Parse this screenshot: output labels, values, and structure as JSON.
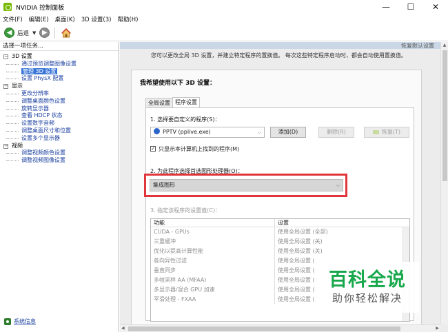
{
  "window": {
    "title": "NVIDIA 控制面板",
    "minimize": "—",
    "maximize": "☐",
    "close": "✕"
  },
  "menu": [
    "文件(F)",
    "编辑(E)",
    "桌面(K)",
    "3D 设置(3)",
    "帮助(H)"
  ],
  "toolbar": {
    "back_label": "后退"
  },
  "left_panel": {
    "header": "选择一项任务...",
    "tree": [
      {
        "label": "3D 设置",
        "level": 0
      },
      {
        "label": "通过预览调整图像设置",
        "level": 1
      },
      {
        "label": "管理 3D 设置",
        "level": 1,
        "selected": true
      },
      {
        "label": "设置 PhysX 配置",
        "level": 1
      },
      {
        "label": "显示",
        "level": 0
      },
      {
        "label": "更改分辨率",
        "level": 1
      },
      {
        "label": "调整桌面颜色设置",
        "level": 1
      },
      {
        "label": "旋转显示器",
        "level": 1
      },
      {
        "label": "查看 HDCP 状态",
        "level": 1
      },
      {
        "label": "设置数字音频",
        "level": 1
      },
      {
        "label": "调整桌面尺寸和位置",
        "level": 1
      },
      {
        "label": "设置多个显示器",
        "level": 1
      },
      {
        "label": "视频",
        "level": 0
      },
      {
        "label": "调整视频颜色设置",
        "level": 1
      },
      {
        "label": "调整视频图像设置",
        "level": 1
      }
    ],
    "system_info": "系统信息"
  },
  "right_panel": {
    "restore_defaults_top": "恢复默认设置",
    "description": "您可以更改全局 3D 设置，并建立特定程序的置换值。 每次这些特定程序启动时，都会自动使用置换值。",
    "section_title": "我希望使用以下 3D 设置：",
    "tabs": {
      "global": "全局设置",
      "program": "程序设置"
    },
    "step1_label": "1. 选择要自定义的程序(S)：",
    "program_select": "PPTV (pplive.exe)",
    "add_button": "添加(D)",
    "delete_button": "删除(R)",
    "restore_button": "恢复(T)",
    "only_show_checkbox": "只显示本计算机上找到的程序(M)",
    "step2_label": "2. 为此程序选择首选图形处理器(O)：",
    "gpu_select": "集成图形",
    "step3_label": "3. 指定该程序的设置值(C)：",
    "table": {
      "headers": [
        "功能",
        "设置"
      ],
      "rows": [
        [
          "CUDA - GPUs",
          "使用全局设置 (全部)"
        ],
        [
          "三重缓冲",
          "使用全局设置 (关)"
        ],
        [
          "优化以提高计算性能",
          "使用全局设置 (关)"
        ],
        [
          "各向异性过滤",
          "使用全局设置 ("
        ],
        [
          "垂直同步",
          "使用全局设置 ("
        ],
        [
          "多帧采样 AA (MFAA)",
          "使用全局设置 ("
        ],
        [
          "多显示器/混合 GPU 加速",
          "使用全局设置 ("
        ],
        [
          "平滑处理 - FXAA",
          "使用全局设置 ("
        ]
      ]
    }
  },
  "watermark": {
    "main": "百科全说",
    "sub": "助你轻松解决"
  },
  "colors": {
    "accent_selected": "#3875d7",
    "highlight": "#e0353b",
    "nvidia_green": "#76b900",
    "watermark_green": "#17a84b"
  }
}
